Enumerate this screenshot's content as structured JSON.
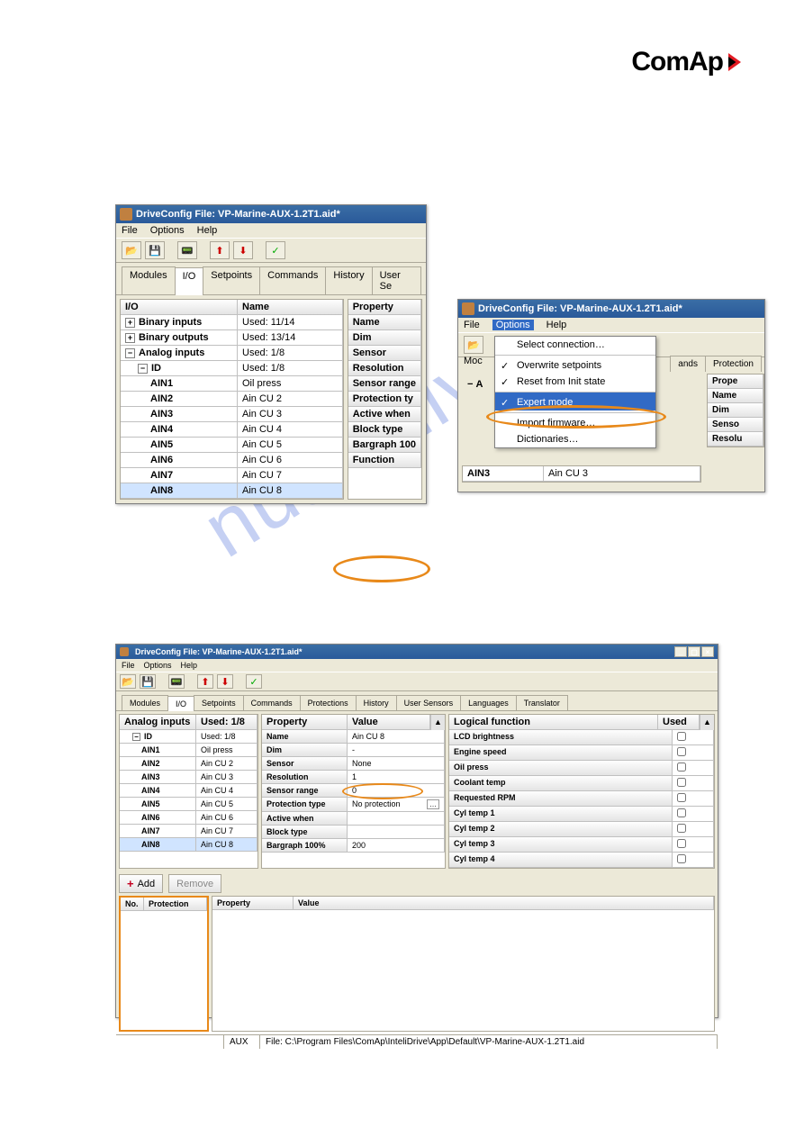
{
  "logo_text": "ComAp",
  "watermark": "nualshive.c",
  "win1": {
    "title": "DriveConfig File: VP-Marine-AUX-1.2T1.aid*",
    "menu": [
      "File",
      "Options",
      "Help"
    ],
    "tabs": [
      "Modules",
      "I/O",
      "Setpoints",
      "Commands",
      "History",
      "User Se"
    ],
    "active_tab": "I/O",
    "left_cols": [
      "I/O",
      "Name"
    ],
    "left_rows": [
      {
        "io": "Binary inputs",
        "name": "Used: 11/14",
        "toggle": "+"
      },
      {
        "io": "Binary outputs",
        "name": "Used: 13/14",
        "toggle": "+"
      },
      {
        "io": "Analog inputs",
        "name": "Used: 1/8",
        "toggle": "−"
      },
      {
        "io": "ID",
        "name": "Used: 1/8",
        "toggle": "−",
        "indent": 1
      },
      {
        "io": "AIN1",
        "name": "Oil press",
        "indent": 2
      },
      {
        "io": "AIN2",
        "name": "Ain CU 2",
        "indent": 2
      },
      {
        "io": "AIN3",
        "name": "Ain CU 3",
        "indent": 2
      },
      {
        "io": "AIN4",
        "name": "Ain CU 4",
        "indent": 2
      },
      {
        "io": "AIN5",
        "name": "Ain CU 5",
        "indent": 2
      },
      {
        "io": "AIN6",
        "name": "Ain CU 6",
        "indent": 2
      },
      {
        "io": "AIN7",
        "name": "Ain CU 7",
        "indent": 2
      },
      {
        "io": "AIN8",
        "name": "Ain CU 8",
        "indent": 2,
        "sel": true
      }
    ],
    "right_rows": [
      "Property",
      "Name",
      "Dim",
      "Sensor",
      "Resolution",
      "Sensor range",
      "Protection ty",
      "Active when",
      "Block type",
      "Bargraph 100",
      "Function"
    ]
  },
  "win2": {
    "title": "DriveConfig File: VP-Marine-AUX-1.2T1.aid*",
    "menu": [
      "File",
      "Options",
      "Help"
    ],
    "tabs_right": [
      "ands",
      "Protection"
    ],
    "options_menu": [
      {
        "label": "Select connection…"
      },
      {
        "label": "Overwrite setpoints",
        "check": true,
        "sep": true
      },
      {
        "label": "Reset from Init state",
        "check": true
      },
      {
        "label": "Expert mode",
        "check": true,
        "sel": true,
        "sep": true
      },
      {
        "label": "Import firmware…",
        "sep": true
      },
      {
        "label": "Dictionaries…"
      }
    ],
    "mini_left": {
      "io": "AIN3",
      "name": "Ain CU 3"
    },
    "mini_right_rows": [
      "Prope",
      "Name",
      "Dim",
      "Senso",
      "Resolu"
    ]
  },
  "win3": {
    "title": "DriveConfig File: VP-Marine-AUX-1.2T1.aid*",
    "menu": [
      "File",
      "Options",
      "Help"
    ],
    "tabs": [
      "Modules",
      "I/O",
      "Setpoints",
      "Commands",
      "Protections",
      "History",
      "User Sensors",
      "Languages",
      "Translator"
    ],
    "active_tab": "I/O",
    "left_cols": [
      "Analog inputs",
      "Used: 1/8"
    ],
    "left_rows": [
      {
        "io": "ID",
        "name": "Used: 1/8",
        "toggle": "−",
        "indent": 1
      },
      {
        "io": "AIN1",
        "name": "Oil press",
        "indent": 2
      },
      {
        "io": "AIN2",
        "name": "Ain CU 2",
        "indent": 2
      },
      {
        "io": "AIN3",
        "name": "Ain CU 3",
        "indent": 2
      },
      {
        "io": "AIN4",
        "name": "Ain CU 4",
        "indent": 2
      },
      {
        "io": "AIN5",
        "name": "Ain CU 5",
        "indent": 2
      },
      {
        "io": "AIN6",
        "name": "Ain CU 6",
        "indent": 2
      },
      {
        "io": "AIN7",
        "name": "Ain CU 7",
        "indent": 2
      },
      {
        "io": "AIN8",
        "name": "Ain CU 8",
        "indent": 2,
        "sel": true
      }
    ],
    "mid_cols": [
      "Property",
      "Value"
    ],
    "mid_rows": [
      {
        "p": "Name",
        "v": "Ain CU 8"
      },
      {
        "p": "Dim",
        "v": "-"
      },
      {
        "p": "Sensor",
        "v": "None"
      },
      {
        "p": "Resolution",
        "v": "1"
      },
      {
        "p": "Sensor range",
        "v": "0"
      },
      {
        "p": "Protection type",
        "v": "No protection",
        "hl": true
      },
      {
        "p": "Active when",
        "v": ""
      },
      {
        "p": "Block type",
        "v": ""
      },
      {
        "p": "Bargraph 100%",
        "v": "200"
      }
    ],
    "right_cols": [
      "Logical function",
      "Used"
    ],
    "right_rows": [
      "LCD brightness",
      "Engine speed",
      "Oil press",
      "Coolant temp",
      "Requested RPM",
      "Cyl temp 1",
      "Cyl temp 2",
      "Cyl temp 3",
      "Cyl temp 4"
    ],
    "add_label": "Add",
    "remove_label": "Remove",
    "prot_cols": [
      "No.",
      "Protection"
    ],
    "prop_cols": [
      "Property",
      "Value"
    ],
    "status_mode": "AUX",
    "status_file": "File: C:\\Program Files\\ComAp\\InteliDrive\\App\\Default\\VP-Marine-AUX-1.2T1.aid"
  }
}
